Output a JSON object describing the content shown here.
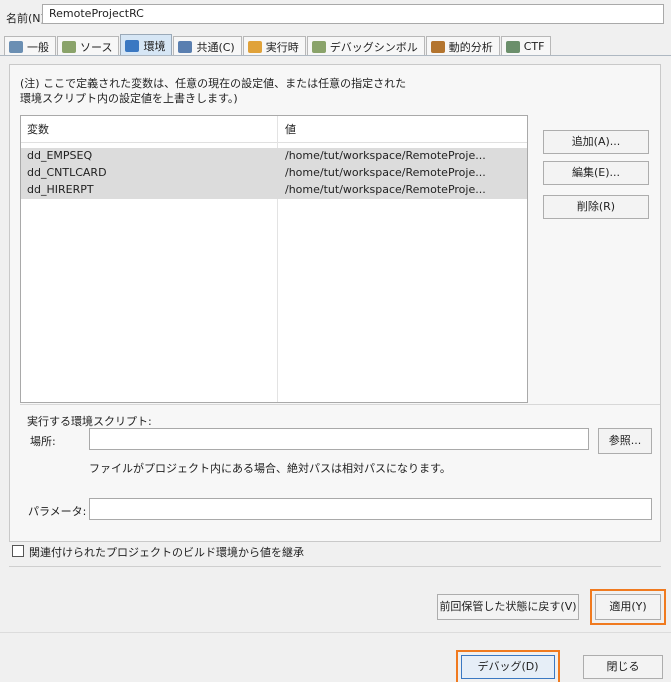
{
  "name": {
    "label": "名前(N):",
    "value": "RemoteProjectRC"
  },
  "tabs": [
    {
      "label": "一般",
      "active": false,
      "icon": "general-icon"
    },
    {
      "label": "ソース",
      "active": false,
      "icon": "source-icon"
    },
    {
      "label": "環境",
      "active": true,
      "icon": "environment-icon"
    },
    {
      "label": "共通(C)",
      "active": false,
      "icon": "common-icon"
    },
    {
      "label": "実行時",
      "active": false,
      "icon": "runtime-icon"
    },
    {
      "label": "デバッグシンボル",
      "active": false,
      "icon": "debug-symbol-icon"
    },
    {
      "label": "動的分析",
      "active": false,
      "icon": "dynamic-analysis-icon"
    },
    {
      "label": "CTF",
      "active": false,
      "icon": "ctf-icon"
    }
  ],
  "note": {
    "line1": "(注) ここで定義された変数は、任意の現在の設定値、または任意の指定された",
    "line2": "環境スクリプト内の設定値を上書きします。)"
  },
  "table": {
    "col_variable": "変数",
    "col_value": "値",
    "rows": [
      {
        "variable": "dd_EMPSEQ",
        "value": "/home/tut/workspace/RemoteProje..."
      },
      {
        "variable": "dd_CNTLCARD",
        "value": "/home/tut/workspace/RemoteProje..."
      },
      {
        "variable": "dd_HIRERPT",
        "value": "/home/tut/workspace/RemoteProje..."
      }
    ]
  },
  "buttons": {
    "add": "追加(A)...",
    "edit": "編集(E)...",
    "delete": "削除(R)",
    "browse": "参照...",
    "revert": "前回保管した状態に戻す(V)",
    "apply": "適用(Y)",
    "debug": "デバッグ(D)",
    "close": "閉じる"
  },
  "script": {
    "group_label": "実行する環境スクリプト:",
    "location_label": "場所:",
    "location_value": "",
    "hint": "ファイルがプロジェクト内にある場合、絶対パスは相対パスになります。",
    "params_label": "パラメータ:",
    "params_value": ""
  },
  "inherit": {
    "label": "関連付けられたプロジェクトのビルド環境から値を継承",
    "checked": false
  },
  "colors": {
    "highlight": "#f07a1f",
    "active_tab": "#d6e6f5",
    "selected_row": "#dcdcdc"
  }
}
